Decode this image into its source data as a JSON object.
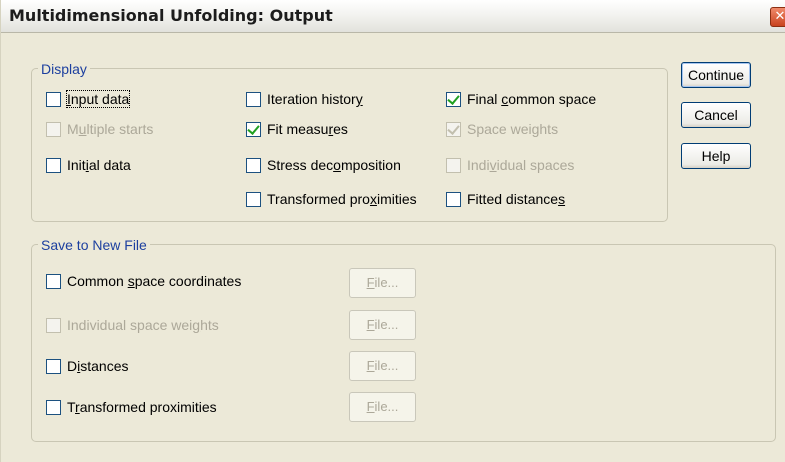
{
  "window": {
    "title": "Multidimensional Unfolding: Output",
    "close_glyph": "✕"
  },
  "display": {
    "label": "Display",
    "options": {
      "input_data": {
        "pre": "",
        "mn": "I",
        "post": "nput data",
        "checked": false,
        "enabled": true
      },
      "multiple_starts": {
        "pre": "M",
        "mn": "u",
        "post": "ltiple starts",
        "checked": false,
        "enabled": false
      },
      "initial_data": {
        "pre": "Init",
        "mn": "i",
        "post": "al data",
        "checked": false,
        "enabled": true
      },
      "iteration_history": {
        "pre": "Iteration histor",
        "mn": "y",
        "post": "",
        "checked": false,
        "enabled": true
      },
      "fit_measures": {
        "pre": "Fit measu",
        "mn": "r",
        "post": "es",
        "checked": true,
        "enabled": true
      },
      "stress_decomposition": {
        "pre": "Stress dec",
        "mn": "o",
        "post": "mposition",
        "checked": false,
        "enabled": true
      },
      "transformed_proximities": {
        "pre": "Transformed pro",
        "mn": "x",
        "post": "imities",
        "checked": false,
        "enabled": true
      },
      "final_common_space": {
        "pre": "Final ",
        "mn": "c",
        "post": "ommon space",
        "checked": true,
        "enabled": true
      },
      "space_weights": {
        "pre": "Space wei",
        "mn": "g",
        "post": "hts",
        "checked": true,
        "enabled": false
      },
      "individual_spaces": {
        "pre": "Indi",
        "mn": "v",
        "post": "idual spaces",
        "checked": false,
        "enabled": false
      },
      "fitted_distances": {
        "pre": "Fitted distance",
        "mn": "s",
        "post": "",
        "checked": false,
        "enabled": true
      }
    }
  },
  "save": {
    "label": "Save to New File",
    "file_button": {
      "mn": "F",
      "post": "ile..."
    },
    "options": {
      "common_space_coordinates": {
        "pre": "Common ",
        "mn": "s",
        "post": "pace coordinates",
        "checked": false,
        "enabled": true
      },
      "individual_space_weights": {
        "pre": "Individual space wei",
        "mn": "g",
        "post": "hts",
        "checked": false,
        "enabled": false
      },
      "distances": {
        "pre": "D",
        "mn": "i",
        "post": "stances",
        "checked": false,
        "enabled": true
      },
      "transformed_proximities": {
        "pre": "T",
        "mn": "r",
        "post": "ansformed proximities",
        "checked": false,
        "enabled": true
      }
    }
  },
  "buttons": {
    "continue": "Continue",
    "cancel": "Cancel",
    "help": "Help"
  }
}
